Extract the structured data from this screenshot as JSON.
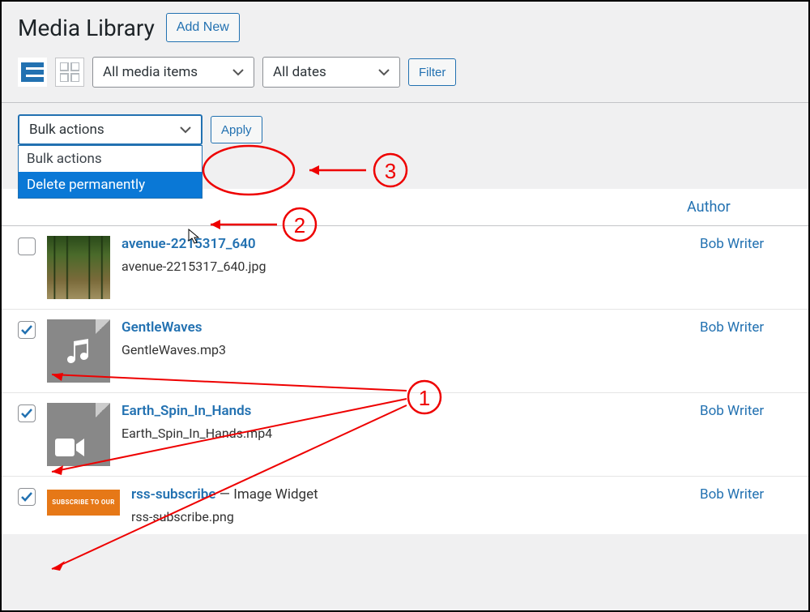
{
  "header": {
    "title": "Media Library",
    "add_new": "Add New"
  },
  "filters": {
    "media_type": "All media items",
    "dates": "All dates",
    "filter_btn": "Filter"
  },
  "bulk": {
    "current": "Bulk actions",
    "apply": "Apply",
    "options": {
      "bulk_actions": "Bulk actions",
      "delete_permanently": "Delete permanently"
    }
  },
  "columns": {
    "author": "Author"
  },
  "items": [
    {
      "checked": false,
      "thumb_type": "tree",
      "title": "avenue-2215317_640",
      "suffix": "",
      "filename": "avenue-2215317_640.jpg",
      "author": "Bob Writer"
    },
    {
      "checked": true,
      "thumb_type": "audio",
      "title": "GentleWaves",
      "suffix": "",
      "filename": "GentleWaves.mp3",
      "author": "Bob Writer"
    },
    {
      "checked": true,
      "thumb_type": "video",
      "title": "Earth_Spin_In_Hands",
      "suffix": "",
      "filename": "Earth_Spin_In_Hands.mp4",
      "author": "Bob Writer"
    },
    {
      "checked": true,
      "thumb_type": "orange",
      "thumb_text": "SUBSCRIBE TO OUR",
      "title": "rss-subscribe",
      "suffix": " — Image Widget",
      "filename": "rss-subscribe.png",
      "author": "Bob Writer"
    }
  ],
  "annotations": {
    "step1": "1",
    "step2": "2",
    "step3": "3"
  }
}
